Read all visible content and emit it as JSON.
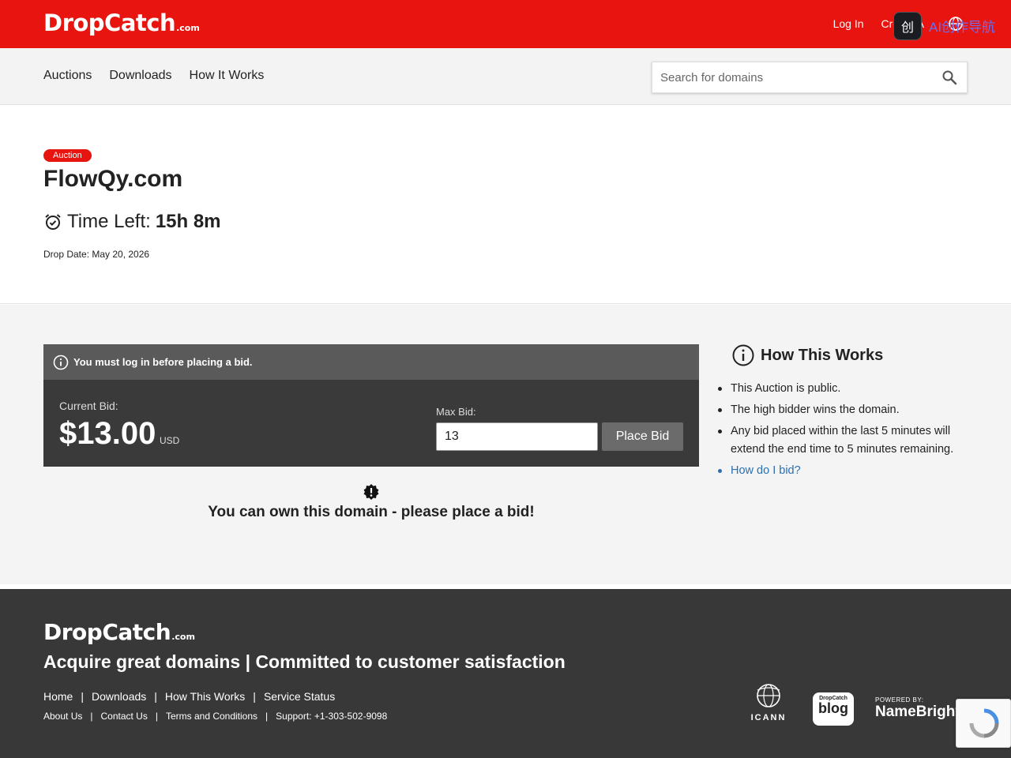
{
  "brand": {
    "logo_main": "DropCatch",
    "logo_suffix": ".com"
  },
  "topbar": {
    "login": "Log In",
    "create_account": "Create A",
    "overlay_text": "AI创作导航"
  },
  "nav": {
    "items": [
      "Auctions",
      "Downloads",
      "How It Works"
    ]
  },
  "search": {
    "placeholder": "Search for domains"
  },
  "auction": {
    "badge": "Auction",
    "domain": "FlowQy.com",
    "time_left_label": "Time Left:",
    "time_left_value": "15h 8m",
    "drop_date": "Drop Date: May 20, 2026"
  },
  "bid": {
    "notice": "You must log in before placing a bid.",
    "current_label": "Current Bid:",
    "current_value": "$13.00",
    "currency": "USD",
    "max_label": "Max Bid:",
    "max_value": "13",
    "place_button": "Place Bid",
    "own_message": "You can own this domain - please place a bid!"
  },
  "how_it_works": {
    "title": "How This Works",
    "items": [
      "This Auction is public.",
      "The high bidder wins the domain.",
      "Any bid placed within the last 5 minutes will extend the end time to 5 minutes remaining.",
      "How do I bid?"
    ]
  },
  "footer": {
    "tagline": "Acquire great domains | Committed to customer satisfaction",
    "nav": [
      "Home",
      "Downloads",
      "How This Works",
      "Service Status"
    ],
    "nav2": [
      "About Us",
      "Contact Us",
      "Terms and Conditions",
      "Support: +1-303-502-9098"
    ],
    "icann": "ICANN",
    "blog_small": "DropCatch",
    "blog_big": "blog",
    "powered_by": "POWERED BY:",
    "namebright": "NameBright"
  },
  "colors": {
    "brand_red": "#e8140f",
    "dark_panel": "#3a3a3a",
    "link_blue": "#2a6fb0"
  }
}
